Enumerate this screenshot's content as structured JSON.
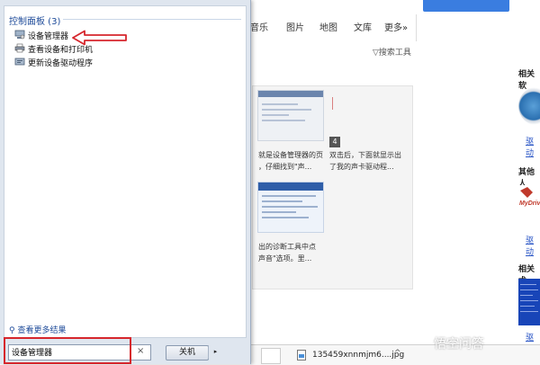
{
  "browser": {
    "nav_tabs": [
      "音乐",
      "图片",
      "地图",
      "文库",
      "更多»"
    ],
    "search_tools": "搜索工具",
    "card_badge": "4",
    "captions": {
      "result1": [
        "就是设备管理器的页",
        "，仔细找到\"声..."
      ],
      "result2": [
        "双击后，下面就显示出",
        "了我的声卡驱动程..."
      ],
      "result3": [
        "出的诊断工具中点",
        "声音\"选项。里..."
      ]
    },
    "sidebar": {
      "section1_title": "相关软",
      "section1_link": "驱动",
      "section2_title": "其他人",
      "section2_link": "驱动",
      "section3_title": "相关术",
      "section3_link": "驱动"
    },
    "download": {
      "filename": "135459xnnmjm6....jpg",
      "caret": "^"
    },
    "watermark": "悟空问答"
  },
  "start_menu": {
    "group_title": "控制面板 (3)",
    "results": [
      {
        "label": "设备管理器",
        "icon": "device-manager-icon"
      },
      {
        "label": "查看设备和打印机",
        "icon": "printer-icon"
      },
      {
        "label": "更新设备驱动程序",
        "icon": "driver-update-icon"
      }
    ],
    "see_more": "查看更多结果",
    "search_value": "设备管理器",
    "clear_glyph": "×",
    "shutdown_label": "关机",
    "shutdown_arrow": "▸"
  },
  "colors": {
    "annotation_red": "#d6262c",
    "link_blue": "#1d4a99"
  }
}
